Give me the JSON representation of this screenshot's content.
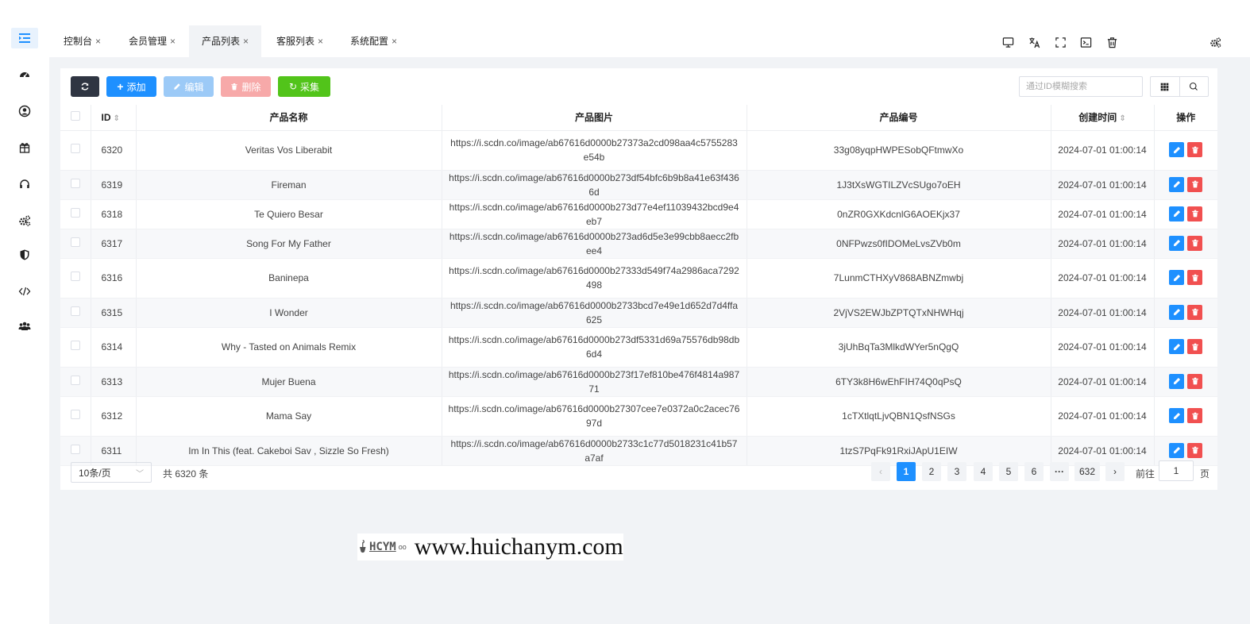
{
  "sidebar": {
    "icons": [
      "menu-indent-icon",
      "dashboard-icon",
      "user-circle-icon",
      "gift-icon",
      "headset-icon",
      "gears-icon",
      "shield-icon",
      "code-icon",
      "users-icon"
    ]
  },
  "tabs": [
    {
      "label": "控制台",
      "close": "×"
    },
    {
      "label": "会员管理",
      "close": "×"
    },
    {
      "label": "产品列表",
      "close": "×"
    },
    {
      "label": "客服列表",
      "close": "×"
    },
    {
      "label": "系统配置",
      "close": "×"
    }
  ],
  "toolbar": {
    "add_label": "添加",
    "edit_label": "编辑",
    "delete_label": "删除",
    "collect_label": "采集",
    "search_placeholder": "通过ID模糊搜索"
  },
  "table": {
    "columns": {
      "id": "ID",
      "name": "产品名称",
      "image": "产品图片",
      "code": "产品编号",
      "created": "创建时间",
      "ops": "操作"
    },
    "rows": [
      {
        "id": "6320",
        "name": "Veritas Vos Liberabit",
        "image": "https://i.scdn.co/image/ab67616d0000b27373a2cd098aa4c5755283e54b",
        "code": "33g08yqpHWPESobQFtmwXo",
        "created": "2024-07-01 01:00:14"
      },
      {
        "id": "6319",
        "name": "Fireman",
        "image": "https://i.scdn.co/image/ab67616d0000b273df54bfc6b9b8a41e63f4366d",
        "code": "1J3tXsWGTILZVcSUgo7oEH",
        "created": "2024-07-01 01:00:14"
      },
      {
        "id": "6318",
        "name": "Te Quiero Besar",
        "image": "https://i.scdn.co/image/ab67616d0000b273d77e4ef11039432bcd9e4eb7",
        "code": "0nZR0GXKdcnlG6AOEKjx37",
        "created": "2024-07-01 01:00:14"
      },
      {
        "id": "6317",
        "name": "Song For My Father",
        "image": "https://i.scdn.co/image/ab67616d0000b273ad6d5e3e99cbb8aecc2fbee4",
        "code": "0NFPwzs0fIDOMeLvsZVb0m",
        "created": "2024-07-01 01:00:14"
      },
      {
        "id": "6316",
        "name": "Baninepa",
        "image": "https://i.scdn.co/image/ab67616d0000b27333d549f74a2986aca7292498",
        "code": "7LunmCTHXyV868ABNZmwbj",
        "created": "2024-07-01 01:00:14"
      },
      {
        "id": "6315",
        "name": "I Wonder",
        "image": "https://i.scdn.co/image/ab67616d0000b2733bcd7e49e1d652d7d4ffa625",
        "code": "2VjVS2EWJbZPTQTxNHWHqj",
        "created": "2024-07-01 01:00:14"
      },
      {
        "id": "6314",
        "name": "Why - Tasted on Animals Remix",
        "image": "https://i.scdn.co/image/ab67616d0000b273df5331d69a75576db98db6d4",
        "code": "3jUhBqTa3MlkdWYer5nQgQ",
        "created": "2024-07-01 01:00:14"
      },
      {
        "id": "6313",
        "name": "Mujer Buena",
        "image": "https://i.scdn.co/image/ab67616d0000b273f17ef810be476f4814a98771",
        "code": "6TY3k8H6wEhFIH74Q0qPsQ",
        "created": "2024-07-01 01:00:14"
      },
      {
        "id": "6312",
        "name": "Mama Say",
        "image": "https://i.scdn.co/image/ab67616d0000b27307cee7e0372a0c2acec7697d",
        "code": "1cTXtlqtLjvQBN1QsfNSGs",
        "created": "2024-07-01 01:00:14"
      },
      {
        "id": "6311",
        "name": "Im In This (feat. Cakeboi Sav , Sizzle So Fresh)",
        "image": "https://i.scdn.co/image/ab67616d0000b2733c1c77d5018231c41b57a7af",
        "code": "1tzS7PqFk91RxiJApU1EIW",
        "created": "2024-07-01 01:00:14"
      }
    ]
  },
  "footer": {
    "page_size": "10条/页",
    "total": "共 6320 条",
    "pages": [
      "1",
      "2",
      "3",
      "4",
      "5",
      "6"
    ],
    "ellipsis": "···",
    "last_page": "632",
    "current_page": "1",
    "goto_prefix": "前往",
    "goto_value": "1",
    "goto_suffix": "页"
  },
  "watermark": {
    "logo_text": "HCYM",
    "url": "www.huichanym.com"
  },
  "colors": {
    "primary": "#1e90ff",
    "danger": "#f15050",
    "success": "#52c41a",
    "dark": "#2f3542"
  }
}
